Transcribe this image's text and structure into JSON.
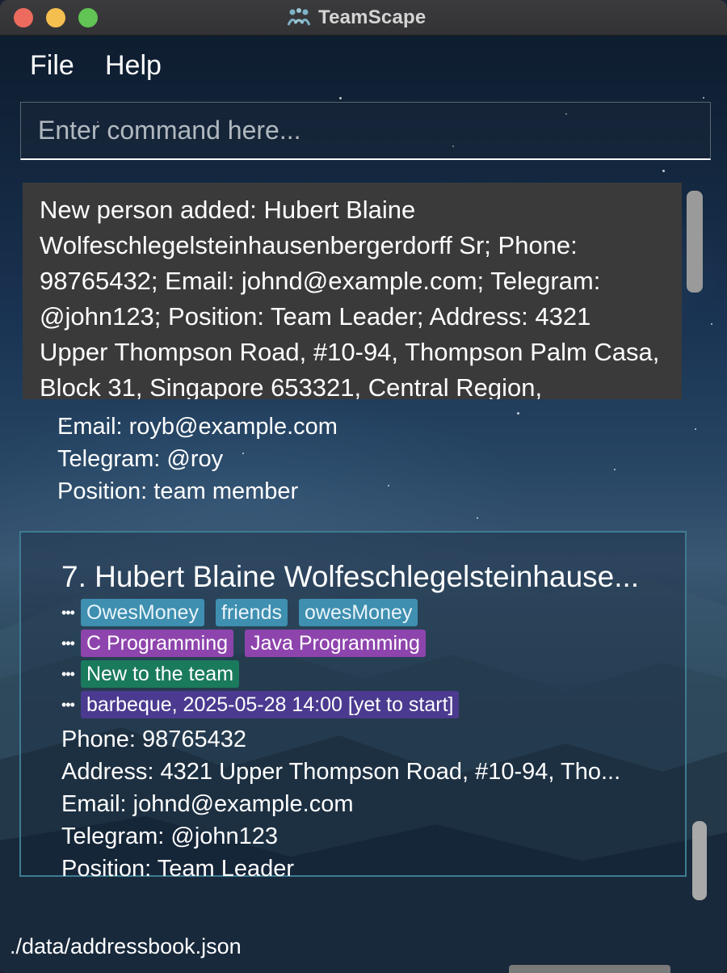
{
  "window": {
    "title": "TeamScape"
  },
  "menu": {
    "file": "File",
    "help": "Help"
  },
  "command": {
    "placeholder": "Enter command here...",
    "value": ""
  },
  "result": {
    "text": "New person added: Hubert Blaine Wolfeschlegelsteinhausenbergerdorff Sr; Phone: 98765432; Email: johnd@example.com; Telegram: @john123; Position: Team Leader; Address: 4321 Upper Thompson Road, #10-94, Thompson Palm Casa, Block 31, Singapore 653321, Central Region,"
  },
  "partial_card": {
    "email": "Email: royb@example.com",
    "telegram": "Telegram: @roy",
    "position": "Position: team member"
  },
  "card": {
    "name": "7. Hubert Blaine Wolfeschlegelsteinhause...",
    "tags": [
      "OwesMoney",
      "friends",
      "owesMoney"
    ],
    "skills": [
      "C Programming",
      "Java Programming"
    ],
    "remarks": [
      "New to the team"
    ],
    "events": [
      "barbeque, 2025-05-28 14:00 [yet to start]"
    ],
    "dots": "•••",
    "phone": "Phone: 98765432",
    "address": "Address: 4321 Upper Thompson Road, #10-94, Tho...",
    "email": "Email: johnd@example.com",
    "telegram": "Telegram: @john123",
    "position": "Position: Team Leader"
  },
  "status": {
    "path": "./data/addressbook.json"
  },
  "colors": {
    "tag": "#3e8fb0",
    "skill": "#8e44ad",
    "remark": "#1a7a5c",
    "event": "#4b3a8f",
    "card_border": "#3e7b91",
    "result_bg": "#3a3a3a"
  }
}
